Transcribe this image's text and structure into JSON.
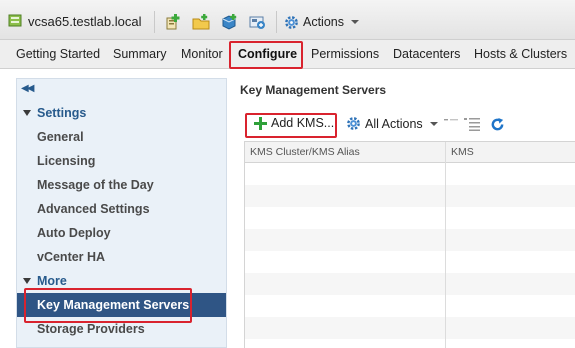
{
  "header": {
    "title": "vcsa65.testlab.local",
    "actions_label": "Actions"
  },
  "tabs": [
    {
      "label": "Getting Started"
    },
    {
      "label": "Summary"
    },
    {
      "label": "Monitor"
    },
    {
      "label": "Configure",
      "active": true
    },
    {
      "label": "Permissions"
    },
    {
      "label": "Datacenters"
    },
    {
      "label": "Hosts & Clusters"
    }
  ],
  "sidebar": {
    "collapse_glyph": "◀◀",
    "settings_label": "Settings",
    "settings_items": [
      {
        "label": "General"
      },
      {
        "label": "Licensing"
      },
      {
        "label": "Message of the Day"
      },
      {
        "label": "Advanced Settings"
      },
      {
        "label": "Auto Deploy"
      },
      {
        "label": "vCenter HA"
      }
    ],
    "more_label": "More",
    "more_items": [
      {
        "label": "Key Management Servers",
        "selected": true
      },
      {
        "label": "Storage Providers"
      }
    ]
  },
  "main": {
    "title": "Key Management Servers",
    "toolbar": {
      "add_kms_label": "Add KMS...",
      "all_actions_label": "All Actions"
    },
    "table": {
      "columns": [
        "KMS Cluster/KMS Alias",
        "KMS"
      ]
    }
  },
  "colors": {
    "highlight_box": "#d9232e",
    "selected_nav": "#2f5585",
    "nav_text": "#275a8c"
  }
}
